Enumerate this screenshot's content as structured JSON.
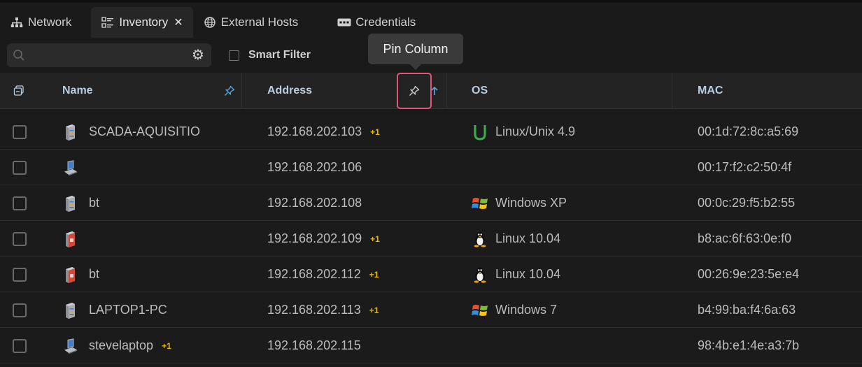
{
  "tabs": [
    {
      "label": "Network",
      "icon": "network-tree-icon"
    },
    {
      "label": "Inventory",
      "icon": "inventory-list-icon",
      "active": true
    },
    {
      "label": "External Hosts",
      "icon": "globe-icon"
    },
    {
      "label": "Credentials",
      "icon": "credentials-card-icon"
    }
  ],
  "tab_close": "✕",
  "search": {
    "placeholder": "",
    "value": ""
  },
  "smart_filter": {
    "label": "Smart Filter",
    "checked": false
  },
  "tooltip": "Pin Column",
  "columns": {
    "name": "Name",
    "address": "Address",
    "os": "OS",
    "mac": "MAC"
  },
  "rows": [
    {
      "name": "SCADA-AQUISITIO",
      "name_badge": "",
      "device": "server",
      "address": "192.168.202.103",
      "addr_badge": "+1",
      "os": "Linux/Unix 4.9",
      "os_icon": "linux-unix-icon",
      "mac": "00:1d:72:8c:a5:69"
    },
    {
      "name": "",
      "name_badge": "",
      "device": "laptop",
      "address": "192.168.202.106",
      "addr_badge": "",
      "os": "",
      "os_icon": "",
      "mac": "00:17:f2:c2:50:4f"
    },
    {
      "name": "bt",
      "name_badge": "",
      "device": "server",
      "address": "192.168.202.108",
      "addr_badge": "",
      "os": "Windows XP",
      "os_icon": "windows-icon",
      "mac": "00:0c:29:f5:b2:55"
    },
    {
      "name": "",
      "name_badge": "",
      "device": "server-red",
      "address": "192.168.202.109",
      "addr_badge": "+1",
      "os": "Linux 10.04",
      "os_icon": "tux-icon",
      "mac": "b8:ac:6f:63:0e:f0"
    },
    {
      "name": "bt",
      "name_badge": "",
      "device": "server-red",
      "address": "192.168.202.112",
      "addr_badge": "+1",
      "os": "Linux 10.04",
      "os_icon": "tux-icon",
      "mac": "00:26:9e:23:5e:e4"
    },
    {
      "name": "LAPTOP1-PC",
      "name_badge": "",
      "device": "server",
      "address": "192.168.202.113",
      "addr_badge": "+1",
      "os": "Windows 7",
      "os_icon": "windows-icon",
      "mac": "b4:99:ba:f4:6a:63"
    },
    {
      "name": "stevelaptop",
      "name_badge": "+1",
      "device": "laptop",
      "address": "192.168.202.115",
      "addr_badge": "",
      "os": "",
      "os_icon": "",
      "mac": "98:4b:e1:4e:a3:7b"
    }
  ],
  "colors": {
    "accent_highlight": "#e0567a",
    "badge": "#e6b800",
    "header_text": "#b8cde0",
    "linux_unix": "#3fae4a"
  }
}
